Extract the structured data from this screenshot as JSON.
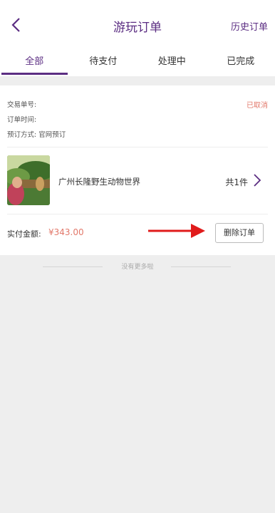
{
  "header": {
    "title": "游玩订单",
    "history_label": "历史订单"
  },
  "tabs": [
    {
      "label": "全部",
      "active": true
    },
    {
      "label": "待支付",
      "active": false
    },
    {
      "label": "处理中",
      "active": false
    },
    {
      "label": "已完成",
      "active": false
    }
  ],
  "order": {
    "trade_no_label": "交易单号:",
    "order_time_label": "订单时间:",
    "booking_method_label": "预订方式: 官网预订",
    "status": "已取消",
    "product_name": "广州长隆野生动物世界",
    "count": "共1件",
    "amount_label": "实付金额:",
    "amount_value": "¥343.00",
    "delete_label": "删除订单"
  },
  "footer": {
    "no_more": "没有更多啦"
  },
  "colors": {
    "accent": "#5b2d82",
    "price": "#e2786a",
    "arrow": "#e01b1b"
  }
}
